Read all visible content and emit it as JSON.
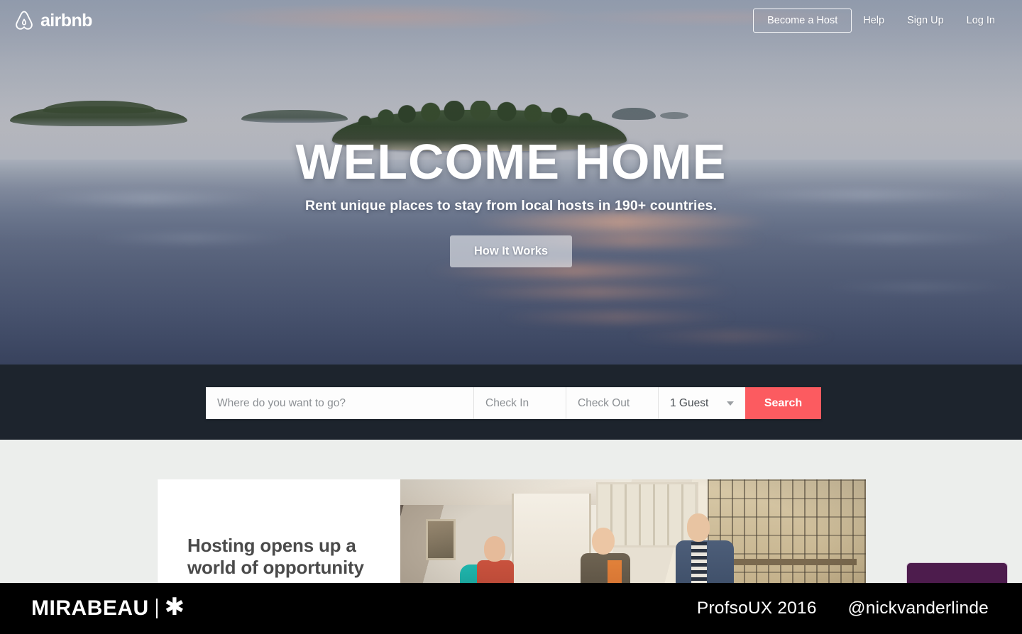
{
  "brand": {
    "name": "airbnb",
    "logo_icon": "airbnb-belo-icon"
  },
  "nav": {
    "become_host": "Become a Host",
    "help": "Help",
    "sign_up": "Sign Up",
    "log_in": "Log In"
  },
  "hero": {
    "title": "WELCOME HOME",
    "subtitle": "Rent unique places to stay from local hosts in 190+ countries.",
    "cta": "How It Works",
    "scene_description": "Forested islands on calm water at dusk"
  },
  "search": {
    "destination_placeholder": "Where do you want to go?",
    "checkin_placeholder": "Check In",
    "checkout_placeholder": "Check Out",
    "guests_value": "1 Guest",
    "guests_caret_icon": "chevron-down-icon",
    "search_button": "Search",
    "search_button_color": "#fc5b60",
    "band_color": "#1d242d"
  },
  "promo": {
    "heading_line1": "Hosting opens up a",
    "heading_line2": "world of opportunity",
    "photo_description": "Three women greeting each other in a bright home interior"
  },
  "footer": {
    "company": "MIRABEAU",
    "company_mark_icon": "asterisk-icon",
    "event": "ProfsoUX 2016",
    "handle": "@nickvanderlinde",
    "background_color": "#000000"
  }
}
